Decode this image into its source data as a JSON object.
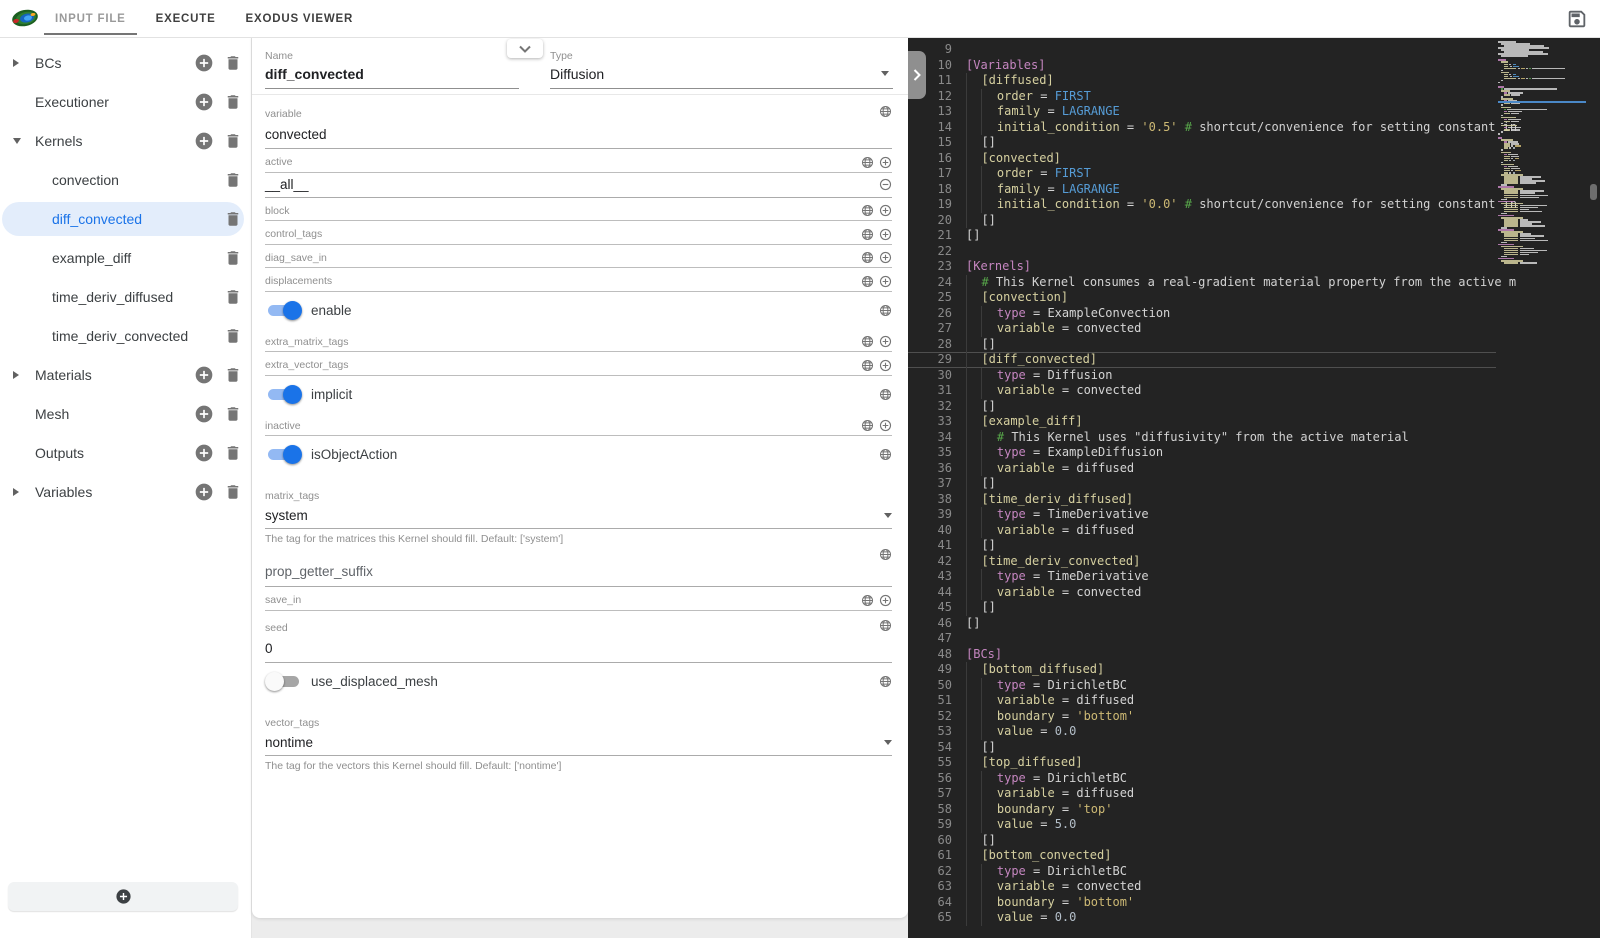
{
  "topbar": {
    "tabs": [
      {
        "label": "INPUT FILE",
        "active": true
      },
      {
        "label": "EXECUTE",
        "active": false
      },
      {
        "label": "EXODUS VIEWER",
        "active": false
      }
    ]
  },
  "sidebar": {
    "items": [
      {
        "label": "BCs",
        "arrow": "right",
        "add": true,
        "delete": true,
        "child": false,
        "selected": false
      },
      {
        "label": "Executioner",
        "arrow": "none",
        "add": true,
        "delete": true,
        "child": false,
        "selected": false
      },
      {
        "label": "Kernels",
        "arrow": "down",
        "add": true,
        "delete": true,
        "child": false,
        "selected": false
      },
      {
        "label": "convection",
        "arrow": "none",
        "add": false,
        "delete": true,
        "child": true,
        "selected": false
      },
      {
        "label": "diff_convected",
        "arrow": "none",
        "add": false,
        "delete": true,
        "child": true,
        "selected": true
      },
      {
        "label": "example_diff",
        "arrow": "none",
        "add": false,
        "delete": true,
        "child": true,
        "selected": false
      },
      {
        "label": "time_deriv_diffused",
        "arrow": "none",
        "add": false,
        "delete": true,
        "child": true,
        "selected": false
      },
      {
        "label": "time_deriv_convected",
        "arrow": "none",
        "add": false,
        "delete": true,
        "child": true,
        "selected": false
      },
      {
        "label": "Materials",
        "arrow": "right",
        "add": true,
        "delete": true,
        "child": false,
        "selected": false
      },
      {
        "label": "Mesh",
        "arrow": "none",
        "add": true,
        "delete": true,
        "child": false,
        "selected": false
      },
      {
        "label": "Outputs",
        "arrow": "none",
        "add": true,
        "delete": true,
        "child": false,
        "selected": false
      },
      {
        "label": "Variables",
        "arrow": "right",
        "add": true,
        "delete": true,
        "child": false,
        "selected": false
      }
    ]
  },
  "form": {
    "name_label": "Name",
    "name_value": "diff_convected",
    "type_label": "Type",
    "type_value": "Diffusion",
    "fields": [
      {
        "kind": "text",
        "label": "variable",
        "value": "convected",
        "icons": [
          "globe"
        ]
      },
      {
        "kind": "multi",
        "label": "active",
        "value": "__all__",
        "label_icons": [
          "globe",
          "add"
        ],
        "value_icons": [
          "remove"
        ]
      },
      {
        "kind": "empty",
        "label": "block",
        "icons": [
          "globe",
          "add"
        ]
      },
      {
        "kind": "empty",
        "label": "control_tags",
        "icons": [
          "globe",
          "add"
        ]
      },
      {
        "kind": "empty",
        "label": "diag_save_in",
        "icons": [
          "globe",
          "add"
        ]
      },
      {
        "kind": "empty",
        "label": "displacements",
        "icons": [
          "globe",
          "add"
        ]
      },
      {
        "kind": "toggle",
        "label": "enable",
        "value": true,
        "icons": [
          "globe"
        ]
      },
      {
        "kind": "empty",
        "label": "extra_matrix_tags",
        "icons": [
          "globe",
          "add"
        ]
      },
      {
        "kind": "empty",
        "label": "extra_vector_tags",
        "icons": [
          "globe",
          "add"
        ]
      },
      {
        "kind": "toggle",
        "label": "implicit",
        "value": true,
        "icons": [
          "globe"
        ]
      },
      {
        "kind": "empty",
        "label": "inactive",
        "icons": [
          "globe",
          "add"
        ]
      },
      {
        "kind": "toggle",
        "label": "isObjectAction",
        "value": true,
        "icons": [
          "globe"
        ]
      },
      {
        "kind": "select",
        "label": "matrix_tags",
        "value": "system",
        "helper": "The tag for the matrices this Kernel should fill. Default: ['system']"
      },
      {
        "kind": "placeholder",
        "label": "prop_getter_suffix",
        "icons": [
          "globe"
        ]
      },
      {
        "kind": "empty",
        "label": "save_in",
        "icons": [
          "globe",
          "add"
        ]
      },
      {
        "kind": "text",
        "label": "seed",
        "value": "0",
        "icons": [
          "globe"
        ]
      },
      {
        "kind": "toggle",
        "label": "use_displaced_mesh",
        "value": false,
        "icons": [
          "globe"
        ]
      },
      {
        "kind": "select",
        "label": "vector_tags",
        "value": "nontime",
        "helper": "The tag for the vectors this Kernel should fill. Default: ['nontime']"
      }
    ]
  },
  "editor": {
    "current_line": 29,
    "lines": [
      {
        "n": 9,
        "i": 0,
        "t": []
      },
      {
        "n": 10,
        "i": 0,
        "t": [
          [
            "hdr",
            "[Variables]"
          ]
        ]
      },
      {
        "n": 11,
        "i": 1,
        "t": [
          [
            "sub",
            "[diffused]"
          ]
        ]
      },
      {
        "n": 12,
        "i": 2,
        "t": [
          [
            "key",
            "order"
          ],
          [
            "pln",
            " = "
          ],
          [
            "kw",
            "FIRST"
          ]
        ]
      },
      {
        "n": 13,
        "i": 2,
        "t": [
          [
            "key",
            "family"
          ],
          [
            "pln",
            " = "
          ],
          [
            "kw",
            "LAGRANGE"
          ]
        ]
      },
      {
        "n": 14,
        "i": 2,
        "t": [
          [
            "key",
            "initial_condition"
          ],
          [
            "pln",
            " = "
          ],
          [
            "str",
            "'0.5'"
          ],
          [
            "pln",
            " "
          ],
          [
            "hash",
            "#"
          ],
          [
            "cmt",
            " shortcut/convenience for setting constant in"
          ]
        ]
      },
      {
        "n": 15,
        "i": 1,
        "t": [
          [
            "pln",
            "[]"
          ]
        ]
      },
      {
        "n": 16,
        "i": 1,
        "t": [
          [
            "sub",
            "[convected]"
          ]
        ]
      },
      {
        "n": 17,
        "i": 2,
        "t": [
          [
            "key",
            "order"
          ],
          [
            "pln",
            " = "
          ],
          [
            "kw",
            "FIRST"
          ]
        ]
      },
      {
        "n": 18,
        "i": 2,
        "t": [
          [
            "key",
            "family"
          ],
          [
            "pln",
            " = "
          ],
          [
            "kw",
            "LAGRANGE"
          ]
        ]
      },
      {
        "n": 19,
        "i": 2,
        "t": [
          [
            "key",
            "initial_condition"
          ],
          [
            "pln",
            " = "
          ],
          [
            "str",
            "'0.0'"
          ],
          [
            "pln",
            " "
          ],
          [
            "hash",
            "#"
          ],
          [
            "cmt",
            " shortcut/convenience for setting constant in"
          ]
        ]
      },
      {
        "n": 20,
        "i": 1,
        "t": [
          [
            "pln",
            "[]"
          ]
        ]
      },
      {
        "n": 21,
        "i": 0,
        "t": [
          [
            "pln",
            "[]"
          ]
        ]
      },
      {
        "n": 22,
        "i": 0,
        "t": []
      },
      {
        "n": 23,
        "i": 0,
        "t": [
          [
            "hdr",
            "[Kernels]"
          ]
        ]
      },
      {
        "n": 24,
        "i": 1,
        "t": [
          [
            "hash",
            "#"
          ],
          [
            "cmt",
            " This Kernel consumes a real-gradient material property from the active m"
          ]
        ]
      },
      {
        "n": 25,
        "i": 1,
        "t": [
          [
            "sub",
            "[convection]"
          ]
        ]
      },
      {
        "n": 26,
        "i": 2,
        "t": [
          [
            "typ",
            "type"
          ],
          [
            "pln",
            " = ExampleConvection"
          ]
        ]
      },
      {
        "n": 27,
        "i": 2,
        "t": [
          [
            "key",
            "variable"
          ],
          [
            "pln",
            " = convected"
          ]
        ]
      },
      {
        "n": 28,
        "i": 1,
        "t": [
          [
            "pln",
            "[]"
          ]
        ]
      },
      {
        "n": 29,
        "i": 1,
        "t": [
          [
            "sub",
            "[diff_convected]"
          ]
        ]
      },
      {
        "n": 30,
        "i": 2,
        "t": [
          [
            "typ",
            "type"
          ],
          [
            "pln",
            " = Diffusion"
          ]
        ]
      },
      {
        "n": 31,
        "i": 2,
        "t": [
          [
            "key",
            "variable"
          ],
          [
            "pln",
            " = convected"
          ]
        ]
      },
      {
        "n": 32,
        "i": 1,
        "t": [
          [
            "pln",
            "[]"
          ]
        ]
      },
      {
        "n": 33,
        "i": 1,
        "t": [
          [
            "sub",
            "[example_diff]"
          ]
        ]
      },
      {
        "n": 34,
        "i": 2,
        "t": [
          [
            "hash",
            "#"
          ],
          [
            "cmt",
            " This Kernel uses \"diffusivity\" from the active material"
          ]
        ]
      },
      {
        "n": 35,
        "i": 2,
        "t": [
          [
            "typ",
            "type"
          ],
          [
            "pln",
            " = ExampleDiffusion"
          ]
        ]
      },
      {
        "n": 36,
        "i": 2,
        "t": [
          [
            "key",
            "variable"
          ],
          [
            "pln",
            " = diffused"
          ]
        ]
      },
      {
        "n": 37,
        "i": 1,
        "t": [
          [
            "pln",
            "[]"
          ]
        ]
      },
      {
        "n": 38,
        "i": 1,
        "t": [
          [
            "sub",
            "[time_deriv_diffused]"
          ]
        ]
      },
      {
        "n": 39,
        "i": 2,
        "t": [
          [
            "typ",
            "type"
          ],
          [
            "pln",
            " = TimeDerivative"
          ]
        ]
      },
      {
        "n": 40,
        "i": 2,
        "t": [
          [
            "key",
            "variable"
          ],
          [
            "pln",
            " = diffused"
          ]
        ]
      },
      {
        "n": 41,
        "i": 1,
        "t": [
          [
            "pln",
            "[]"
          ]
        ]
      },
      {
        "n": 42,
        "i": 1,
        "t": [
          [
            "sub",
            "[time_deriv_convected]"
          ]
        ]
      },
      {
        "n": 43,
        "i": 2,
        "t": [
          [
            "typ",
            "type"
          ],
          [
            "pln",
            " = TimeDerivative"
          ]
        ]
      },
      {
        "n": 44,
        "i": 2,
        "t": [
          [
            "key",
            "variable"
          ],
          [
            "pln",
            " = convected"
          ]
        ]
      },
      {
        "n": 45,
        "i": 1,
        "t": [
          [
            "pln",
            "[]"
          ]
        ]
      },
      {
        "n": 46,
        "i": 0,
        "t": [
          [
            "pln",
            "[]"
          ]
        ]
      },
      {
        "n": 47,
        "i": 0,
        "t": []
      },
      {
        "n": 48,
        "i": 0,
        "t": [
          [
            "hdr",
            "[BCs]"
          ]
        ]
      },
      {
        "n": 49,
        "i": 1,
        "t": [
          [
            "sub",
            "[bottom_diffused]"
          ]
        ]
      },
      {
        "n": 50,
        "i": 2,
        "t": [
          [
            "typ",
            "type"
          ],
          [
            "pln",
            " = DirichletBC"
          ]
        ]
      },
      {
        "n": 51,
        "i": 2,
        "t": [
          [
            "key",
            "variable"
          ],
          [
            "pln",
            " = diffused"
          ]
        ]
      },
      {
        "n": 52,
        "i": 2,
        "t": [
          [
            "key",
            "boundary"
          ],
          [
            "pln",
            " = "
          ],
          [
            "str",
            "'bottom'"
          ]
        ]
      },
      {
        "n": 53,
        "i": 2,
        "t": [
          [
            "key",
            "value"
          ],
          [
            "pln",
            " = "
          ],
          [
            "num",
            "0.0"
          ]
        ]
      },
      {
        "n": 54,
        "i": 1,
        "t": [
          [
            "pln",
            "[]"
          ]
        ]
      },
      {
        "n": 55,
        "i": 1,
        "t": [
          [
            "sub",
            "[top_diffused]"
          ]
        ]
      },
      {
        "n": 56,
        "i": 2,
        "t": [
          [
            "typ",
            "type"
          ],
          [
            "pln",
            " = DirichletBC"
          ]
        ]
      },
      {
        "n": 57,
        "i": 2,
        "t": [
          [
            "key",
            "variable"
          ],
          [
            "pln",
            " = diffused"
          ]
        ]
      },
      {
        "n": 58,
        "i": 2,
        "t": [
          [
            "key",
            "boundary"
          ],
          [
            "pln",
            " = "
          ],
          [
            "str",
            "'top'"
          ]
        ]
      },
      {
        "n": 59,
        "i": 2,
        "t": [
          [
            "key",
            "value"
          ],
          [
            "pln",
            " = "
          ],
          [
            "num",
            "5.0"
          ]
        ]
      },
      {
        "n": 60,
        "i": 1,
        "t": [
          [
            "pln",
            "[]"
          ]
        ]
      },
      {
        "n": 61,
        "i": 1,
        "t": [
          [
            "sub",
            "[bottom_convected]"
          ]
        ]
      },
      {
        "n": 62,
        "i": 2,
        "t": [
          [
            "typ",
            "type"
          ],
          [
            "pln",
            " = DirichletBC"
          ]
        ]
      },
      {
        "n": 63,
        "i": 2,
        "t": [
          [
            "key",
            "variable"
          ],
          [
            "pln",
            " = convected"
          ]
        ]
      },
      {
        "n": 64,
        "i": 2,
        "t": [
          [
            "key",
            "boundary"
          ],
          [
            "pln",
            " = "
          ],
          [
            "str",
            "'bottom'"
          ]
        ]
      },
      {
        "n": 65,
        "i": 2,
        "t": [
          [
            "key",
            "value"
          ],
          [
            "pln",
            " = "
          ],
          [
            "num",
            "0.0"
          ]
        ]
      }
    ]
  },
  "colors": {
    "accent_blue": "#1a73e8",
    "selected_item_bg": "#e3edfb",
    "icon_gray": "#757575",
    "toggle_on_track": "#93b9f3",
    "editor_bg": "#232323",
    "tokens": {
      "pln": "#d4d4d4",
      "hdr": "#c586c0",
      "typ": "#c586c0",
      "sub": "#d6d0a0",
      "key": "#d6d0a0",
      "kw": "#569cd6",
      "str": "#cdb974",
      "num": "#b4bfc9",
      "hash": "#57a64a",
      "cmt": "#d2d2d2"
    }
  }
}
